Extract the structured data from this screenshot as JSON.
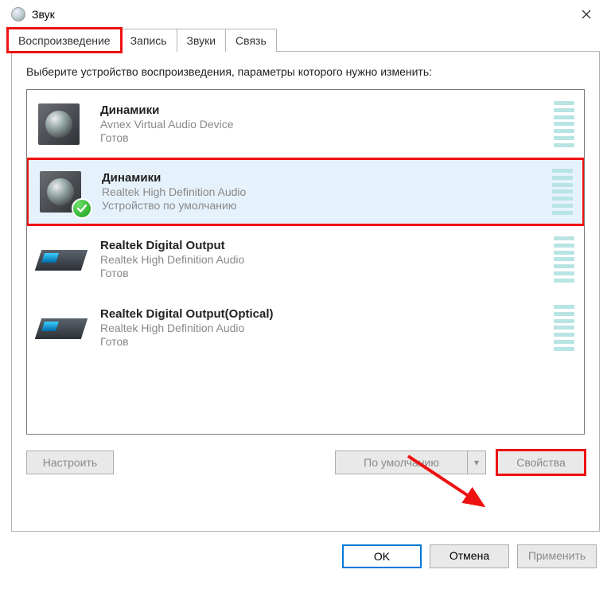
{
  "titlebar": {
    "title": "Звук"
  },
  "tabs": [
    {
      "label": "Воспроизведение",
      "active": true
    },
    {
      "label": "Запись",
      "active": false
    },
    {
      "label": "Звуки",
      "active": false
    },
    {
      "label": "Связь",
      "active": false
    }
  ],
  "instruction": "Выберите устройство воспроизведения, параметры которого нужно изменить:",
  "devices": [
    {
      "name": "Динамики",
      "desc": "Avnex Virtual Audio Device",
      "status": "Готов",
      "icon": "speaker-icon",
      "default": false,
      "selected": false
    },
    {
      "name": "Динамики",
      "desc": "Realtek High Definition Audio",
      "status": "Устройство по умолчанию",
      "icon": "speaker-icon",
      "default": true,
      "selected": true
    },
    {
      "name": "Realtek Digital Output",
      "desc": "Realtek High Definition Audio",
      "status": "Готов",
      "icon": "digital-icon",
      "default": false,
      "selected": false
    },
    {
      "name": "Realtek Digital Output(Optical)",
      "desc": "Realtek High Definition Audio",
      "status": "Готов",
      "icon": "digital-icon",
      "default": false,
      "selected": false
    }
  ],
  "panel_buttons": {
    "configure": "Настроить",
    "set_default": "По умолчанию",
    "properties": "Свойства"
  },
  "dialog_buttons": {
    "ok": "OK",
    "cancel": "Отмена",
    "apply": "Применить"
  }
}
